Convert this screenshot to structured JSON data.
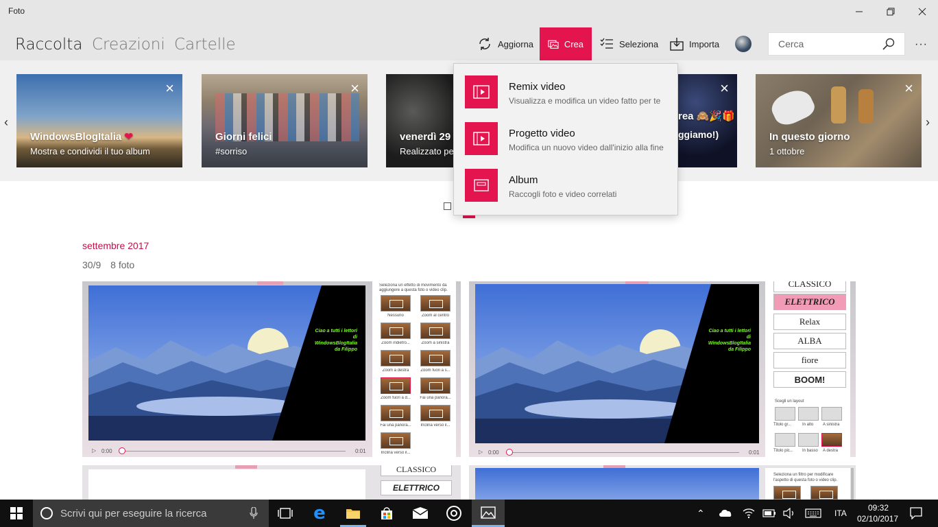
{
  "window": {
    "title": "Foto"
  },
  "nav": {
    "tabs": [
      "Raccolta",
      "Creazioni",
      "Cartelle"
    ]
  },
  "commands": {
    "refresh": "Aggiorna",
    "create": "Crea",
    "select": "Seleziona",
    "import": "Importa"
  },
  "search": {
    "placeholder": "Cerca"
  },
  "carousel": {
    "cards": [
      {
        "title": "WindowsBlogItalia",
        "subtitle": "Mostra e condividi il tuo album"
      },
      {
        "title": "Giorni felici",
        "subtitle": "#sorriso"
      },
      {
        "title": "venerdì 29 s",
        "subtitle": "Realizzato per"
      },
      {
        "title": "rea 🙈🎉🎁",
        "subtitle": "ggiamo!)"
      },
      {
        "title": "In questo giorno",
        "subtitle": "1 ottobre"
      }
    ]
  },
  "create_menu": {
    "items": [
      {
        "title": "Remix video",
        "subtitle": "Visualizza e modifica un video fatto per te"
      },
      {
        "title": "Progetto video",
        "subtitle": "Modifica un nuovo video dall'inizio alla fine"
      },
      {
        "title": "Album",
        "subtitle": "Raccogli foto e video correlati"
      }
    ]
  },
  "collection": {
    "month": "settembre 2017",
    "date": "30/9",
    "count": "8 foto"
  },
  "thumbs": {
    "overlay_text": "Ciao a tutti i lettori di WindowsBlogItalia da Filippo",
    "time_start": "0:00",
    "time_end": "0:01",
    "panel1_header": "Seleziona un effetto di movimento da aggiungere a questa foto o video clip.",
    "motions": [
      "Nessuno",
      "Zoom al centro",
      "Zoom indietro...",
      "Zoom a sinistra",
      "Zoom a destra",
      "Zoom fuori a s...",
      "Zoom fuori a d...",
      "Fai una panora...",
      "Fai una panora...",
      "Inclina verso il...",
      "Inclina verso il..."
    ],
    "styles": [
      "CLASSICO",
      "ELETTRICO",
      "Relax",
      "ALBA",
      "fiore",
      "BOOM!"
    ],
    "layout_header": "Scegli un layout",
    "layouts": [
      "Titolo gr...",
      "In alto",
      "A sinistra",
      "Titolo pic...",
      "In basso",
      "A destra"
    ],
    "filter_header": "Seleziona un filtro per modificare l'aspetto di questa foto o video clip."
  },
  "taskbar": {
    "search_placeholder": "Scrivi qui per eseguire la ricerca",
    "language": "ITA",
    "time": "09:32",
    "date": "02/10/2017"
  },
  "colors": {
    "accent": "#e3144e"
  }
}
